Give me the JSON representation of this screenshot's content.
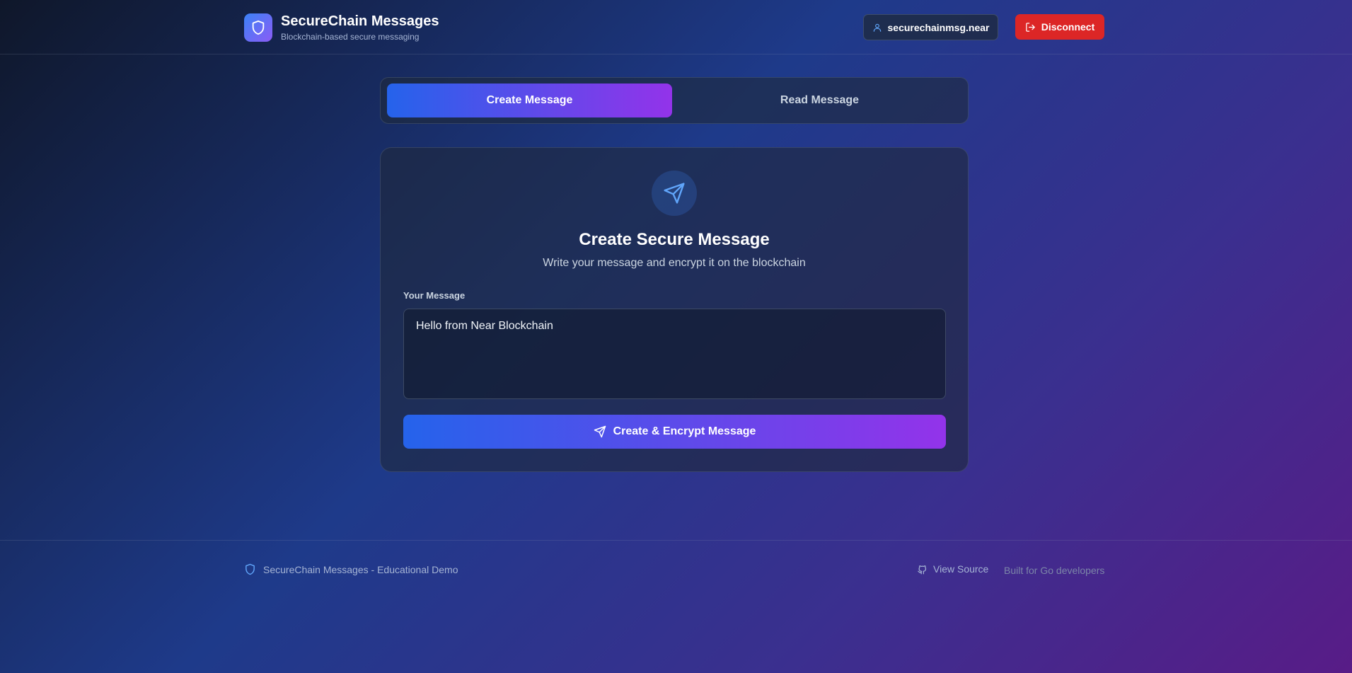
{
  "header": {
    "app_title": "SecureChain Messages",
    "app_subtitle": "Blockchain-based secure messaging",
    "logo_icon": "shield-icon",
    "account_name": "securechainmsg.near",
    "account_icon": "user-icon",
    "disconnect_label": "Disconnect",
    "disconnect_icon": "logout-icon"
  },
  "tabs": [
    {
      "label": "Create Message",
      "active": true
    },
    {
      "label": "Read Message",
      "active": false
    }
  ],
  "card": {
    "icon": "send-icon",
    "title": "Create Secure Message",
    "subtitle": "Write your message and encrypt it on the blockchain",
    "field_label": "Your Message",
    "message_value": "Hello from Near Blockchain",
    "submit_label": "Create & Encrypt Message",
    "submit_icon": "send-icon"
  },
  "footer": {
    "left_text": "SecureChain Messages - Educational Demo",
    "left_icon": "shield-icon",
    "source_label": "View Source",
    "source_icon": "github-icon",
    "built_text": "Built for Go developers"
  },
  "colors": {
    "accent_blue": "#2563eb",
    "accent_purple": "#9333ea",
    "danger": "#dc2626",
    "icon_blue": "#60a5fa"
  }
}
